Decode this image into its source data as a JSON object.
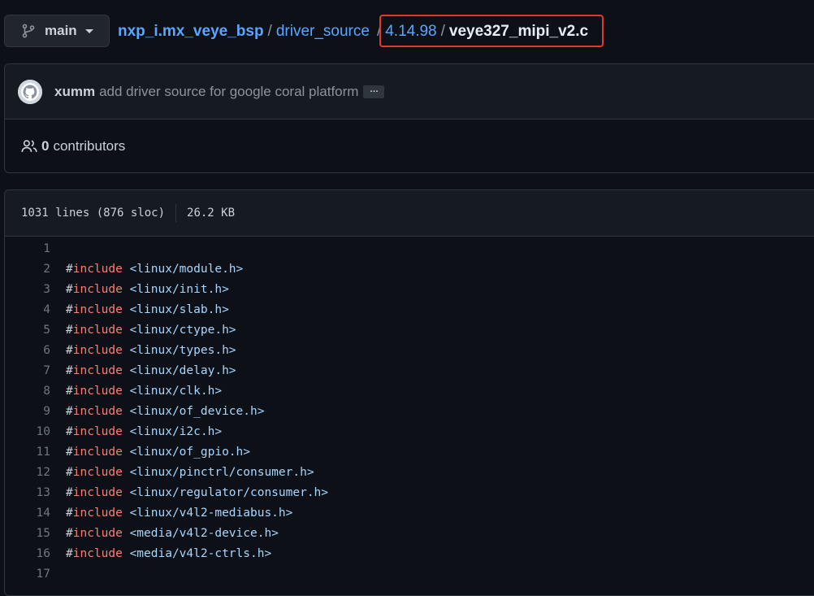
{
  "branch": {
    "label": "main",
    "icon": "git-branch-icon"
  },
  "breadcrumb": {
    "repo": "nxp_i.mx_veye_bsp",
    "folder": "driver_source",
    "subfolder": "4.14.98",
    "file": "veye327_mipi_v2.c",
    "separator": "/"
  },
  "commit": {
    "author": "xumm",
    "message": "add driver source for google coral platform",
    "more": "…"
  },
  "contributors": {
    "count": "0",
    "label": "contributors"
  },
  "file_info": {
    "lines": "1031 lines (876 sloc)",
    "size": "26.2 KB"
  },
  "code": {
    "lines": [
      {
        "num": "1",
        "hash": "",
        "directive": "",
        "path": ""
      },
      {
        "num": "2",
        "hash": "#",
        "directive": "include",
        "path": "<linux/module.h>"
      },
      {
        "num": "3",
        "hash": "#",
        "directive": "include",
        "path": "<linux/init.h>"
      },
      {
        "num": "4",
        "hash": "#",
        "directive": "include",
        "path": "<linux/slab.h>"
      },
      {
        "num": "5",
        "hash": "#",
        "directive": "include",
        "path": "<linux/ctype.h>"
      },
      {
        "num": "6",
        "hash": "#",
        "directive": "include",
        "path": "<linux/types.h>"
      },
      {
        "num": "7",
        "hash": "#",
        "directive": "include",
        "path": "<linux/delay.h>"
      },
      {
        "num": "8",
        "hash": "#",
        "directive": "include",
        "path": "<linux/clk.h>"
      },
      {
        "num": "9",
        "hash": "#",
        "directive": "include",
        "path": "<linux/of_device.h>"
      },
      {
        "num": "10",
        "hash": "#",
        "directive": "include",
        "path": "<linux/i2c.h>"
      },
      {
        "num": "11",
        "hash": "#",
        "directive": "include",
        "path": "<linux/of_gpio.h>"
      },
      {
        "num": "12",
        "hash": "#",
        "directive": "include",
        "path": "<linux/pinctrl/consumer.h>"
      },
      {
        "num": "13",
        "hash": "#",
        "directive": "include",
        "path": "<linux/regulator/consumer.h>"
      },
      {
        "num": "14",
        "hash": "#",
        "directive": "include",
        "path": "<linux/v4l2-mediabus.h>"
      },
      {
        "num": "15",
        "hash": "#",
        "directive": "include",
        "path": "<media/v4l2-device.h>"
      },
      {
        "num": "16",
        "hash": "#",
        "directive": "include",
        "path": "<media/v4l2-ctrls.h>"
      },
      {
        "num": "17",
        "hash": "",
        "directive": "",
        "path": ""
      }
    ]
  },
  "colors": {
    "background": "#0d1117",
    "link": "#58a6ff",
    "keyword": "#ff7b72",
    "string": "#a5d6ff",
    "highlight_box": "#e03a2f"
  }
}
